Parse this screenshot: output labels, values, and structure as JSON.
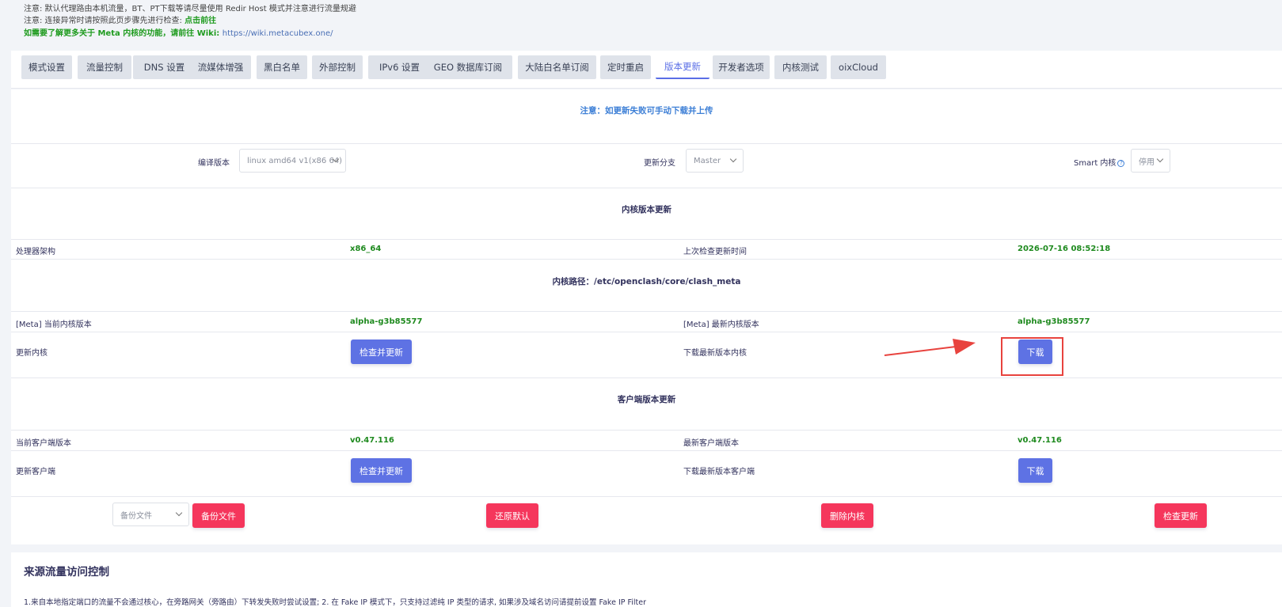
{
  "notices": {
    "line1": "注意: 默认代理路由本机流量，BT、PT下载等请尽量使用 Redir Host 模式并注意进行流量规避",
    "line2_prefix": "注意: 连接异常时请按照此页步骤先进行检查:",
    "line2_link": "点击前往",
    "line3_prefix": "如需要了解更多关于 Meta 内核的功能，请前往 Wiki:",
    "line3_link": "https://wiki.metacubex.one/"
  },
  "tabs": [
    {
      "label": "模式设置"
    },
    {
      "label": "流量控制"
    },
    {
      "label": "DNS 设置"
    },
    {
      "label": "流媒体增强"
    },
    {
      "label": "黑白名单"
    },
    {
      "label": "外部控制"
    },
    {
      "label": "IPv6 设置"
    },
    {
      "label": "GEO 数据库订阅"
    },
    {
      "label": "大陆白名单订阅"
    },
    {
      "label": "定时重启"
    },
    {
      "label": "版本更新",
      "active": true
    },
    {
      "label": "开发者选项"
    },
    {
      "label": "内核测试"
    },
    {
      "label": "oixCloud"
    }
  ],
  "update": {
    "notice": "注意：如更新失败可手动下载并上传",
    "compile_label": "编译版本",
    "compile_value": "linux amd64 v1(x86 64)",
    "branch_label": "更新分支",
    "branch_value": "Master",
    "smart_label": "Smart 内核",
    "smart_help": "?",
    "smart_value": "停用",
    "core_section_title": "内核版本更新",
    "arch_label": "处理器架构",
    "arch_value": "x86_64",
    "last_check_label": "上次检查更新时间",
    "last_check_value": "2026-07-16 08:52:18",
    "core_path": "内核路径：/etc/openclash/core/clash_meta",
    "current_core_label": "[Meta] 当前内核版本",
    "current_core_value": "alpha-g3b85577",
    "latest_core_label": "[Meta] 最新内核版本",
    "latest_core_value": "alpha-g3b85577",
    "update_core_label": "更新内核",
    "check_update_button": "检查并更新",
    "download_core_label": "下载最新版本内核",
    "download_button": "下载",
    "client_section_title": "客户端版本更新",
    "current_client_label": "当前客户端版本",
    "current_client_value": "v0.47.116",
    "latest_client_label": "最新客户端版本",
    "latest_client_value": "v0.47.116",
    "update_client_label": "更新客户端",
    "check_update_client_button": "检查并更新",
    "download_client_label": "下载最新版本客户端",
    "download_client_button": "下载",
    "backup_select_value": "备份文件",
    "backup_button": "备份文件",
    "restore_button": "还原默认",
    "delete_core_button": "删除内核",
    "check_button": "检查更新"
  },
  "access_control": {
    "title": "来源流量访问控制",
    "desc": "1.来自本地指定端口的流量不会通过核心，在旁路网关（旁路由）下转发失败时尝试设置; 2. 在 Fake IP 模式下，只支持过滤纯 IP 类型的请求, 如果涉及域名访问请提前设置 Fake IP Filter"
  },
  "colors": {
    "accent": "#5e72e4",
    "danger": "#f5365c",
    "success": "#1f8a1f",
    "annotation": "#e8433e"
  },
  "annotations": {
    "arrow_icon": "red-arrow-icon"
  }
}
